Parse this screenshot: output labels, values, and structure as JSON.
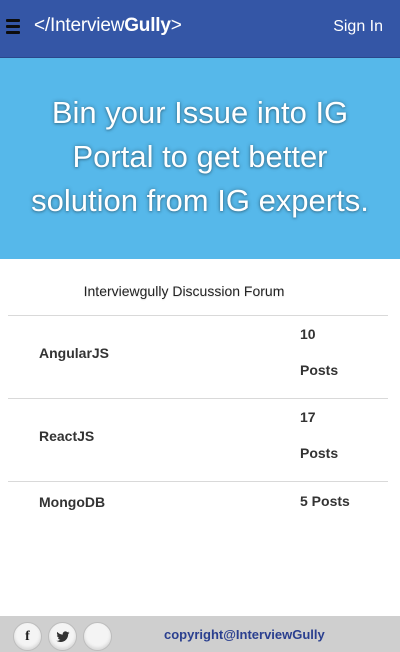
{
  "header": {
    "logo_prefix": "</",
    "logo_thin": "Interview",
    "logo_bold": "Gully",
    "logo_suffix": ">",
    "signin_label": "Sign In",
    "background": "#3456a6"
  },
  "hero": {
    "text": "Bin your Issue into IG Portal to get better solution from IG experts.",
    "background": "#56b8ea"
  },
  "forum": {
    "title": "Interviewgully Discussion Forum",
    "rows": [
      {
        "name": "AngularJS",
        "posts_count": "10",
        "posts_label": "Posts"
      },
      {
        "name": "ReactJS",
        "posts_count": "17",
        "posts_label": "Posts"
      },
      {
        "name": "MongoDB",
        "posts_text": "5 Posts"
      }
    ]
  },
  "footer": {
    "facebook_icon": "f",
    "twitter_icon": "twitter-bird",
    "copyright": "copyright@InterviewGully",
    "background": "#cfcfcf"
  }
}
